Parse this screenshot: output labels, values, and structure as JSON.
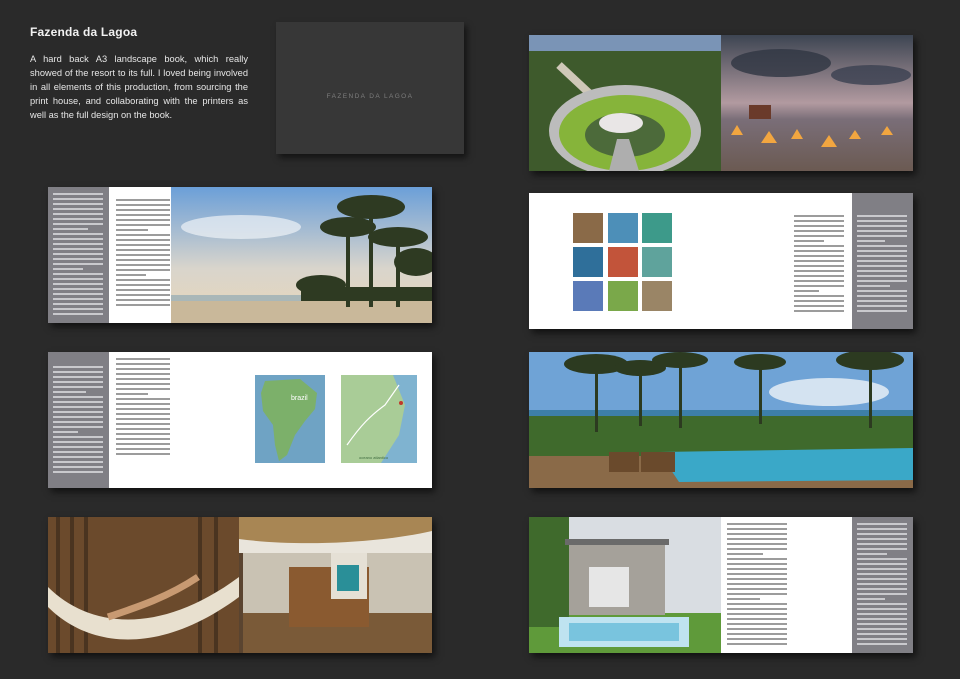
{
  "page": {
    "title": "Fazenda da Lagoa",
    "description": "A hard back A3 landscape book, which really showed of the resort to its full. I loved being involved in all elements of this production, from sourcing the print house, and collaborating with the printers  as well as the full design on the book."
  },
  "cover": {
    "text": "FAZENDA DA LAGOA"
  },
  "maps": {
    "country_label": "brazil",
    "region_label": "oceano atlantico"
  },
  "colors": {
    "background": "#2a2a2a",
    "page_grey": "#807f85",
    "pool_blue": "#3aa8c8",
    "sky_blue": "#6fa3d6"
  }
}
